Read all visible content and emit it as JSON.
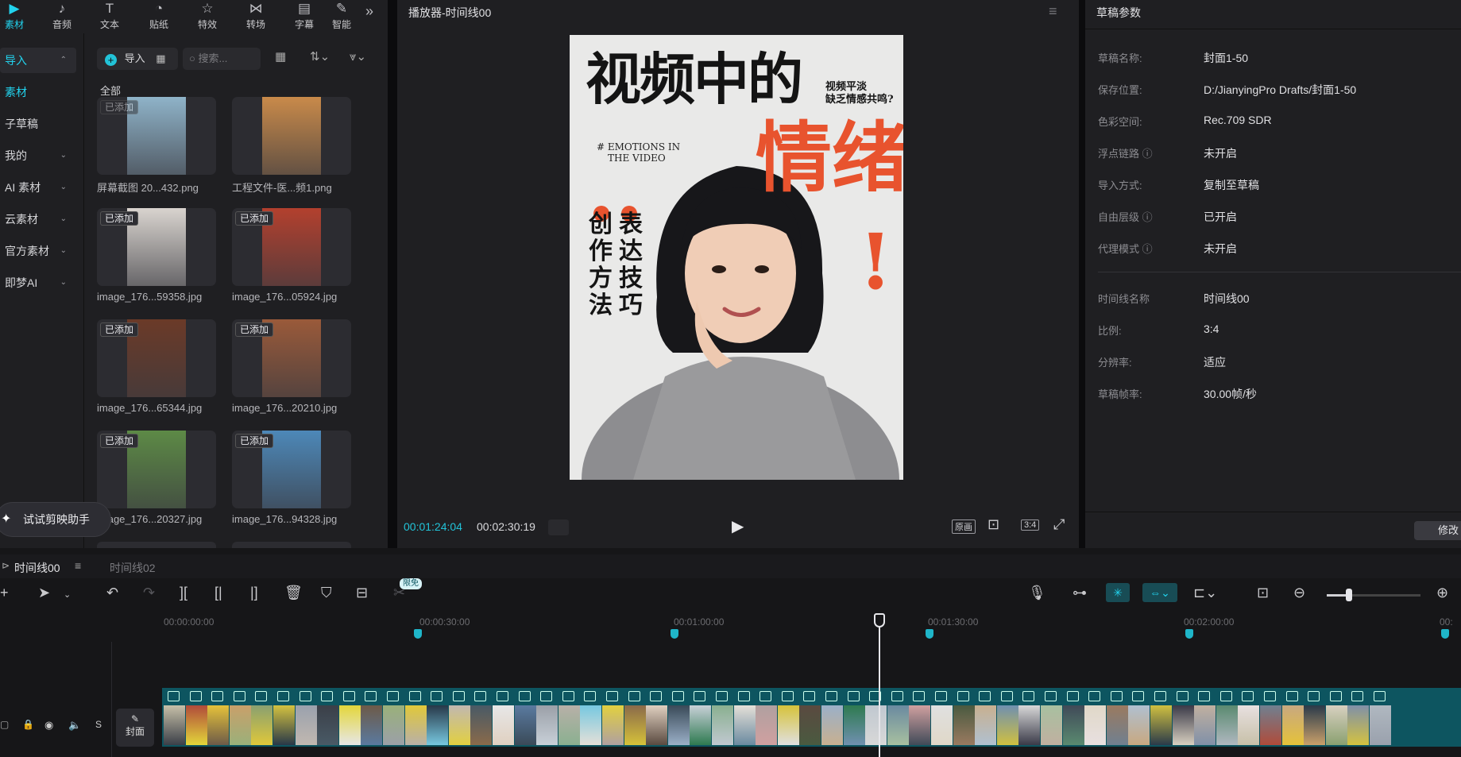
{
  "toolbar": {
    "items": [
      {
        "label": "素材",
        "icon": "media-icon",
        "active": true
      },
      {
        "label": "音频",
        "icon": "audio-icon"
      },
      {
        "label": "文本",
        "icon": "text-icon"
      },
      {
        "label": "贴纸",
        "icon": "sticker-icon"
      },
      {
        "label": "特效",
        "icon": "effects-icon"
      },
      {
        "label": "转场",
        "icon": "transition-icon"
      },
      {
        "label": "字幕",
        "icon": "subtitle-icon"
      },
      {
        "label": "智能",
        "icon": "smart-icon"
      }
    ],
    "more": "»"
  },
  "sidebar": {
    "items": [
      {
        "label": "导入",
        "chevron": "⌃"
      },
      {
        "label": "素材"
      },
      {
        "label": "子草稿"
      },
      {
        "label": "我的",
        "chevron": "⌄"
      },
      {
        "label": "AI 素材",
        "chevron": "⌄"
      },
      {
        "label": "云素材",
        "chevron": "⌄"
      },
      {
        "label": "官方素材",
        "chevron": "⌄"
      },
      {
        "label": "即梦AI",
        "chevron": "⌄"
      }
    ]
  },
  "media": {
    "import_label": "导入",
    "search_placeholder": "搜索...",
    "section_label": "全部",
    "cards": [
      {
        "badge": "已添加",
        "name": "屏幕截图 20...432.png",
        "color": "#8fb3c9"
      },
      {
        "badge": "",
        "name": "工程文件-医...频1.png",
        "color": "#c98a4a"
      },
      {
        "badge": "已添加",
        "name": "image_176...59358.jpg",
        "color": "#d9d4cf"
      },
      {
        "badge": "已添加",
        "name": "image_176...05924.jpg",
        "color": "#b3402e"
      },
      {
        "badge": "已添加",
        "name": "image_176...65344.jpg",
        "color": "#6b3a28"
      },
      {
        "badge": "已添加",
        "name": "image_176...20210.jpg",
        "color": "#9a5a3a"
      },
      {
        "badge": "已添加",
        "name": "image_176...20327.jpg",
        "color": "#5d8a46"
      },
      {
        "badge": "已添加",
        "name": "image_176...94328.jpg",
        "color": "#4d88b8"
      }
    ],
    "assistant_label": "试试剪映助手"
  },
  "player": {
    "title": "播放器-时间线00",
    "current_time": "00:01:24:04",
    "total_time": "00:02:30:19",
    "ratio_btn": "3:4",
    "original_btn": "原画"
  },
  "poster": {
    "title": "视频中的",
    "side_note_1": "视频平淡",
    "side_note_2": "缺乏情感共鸣?",
    "hashtag_1": "# EMOTIONS IN",
    "hashtag_2": "THE VIDEO",
    "emotion": "情绪",
    "vertical_1": "表达技巧",
    "vertical_2": "创作方法",
    "exclaim": "!"
  },
  "props": {
    "title": "草稿参数",
    "rows": [
      {
        "label": "草稿名称:",
        "value": "封面1-50"
      },
      {
        "label": "保存位置:",
        "value": "D:/JianyingPro Drafts/封面1-50"
      },
      {
        "label": "色彩空间:",
        "value": "Rec.709 SDR"
      },
      {
        "label": "浮点链路",
        "value": "未开启"
      },
      {
        "label": "导入方式:",
        "value": "复制至草稿"
      },
      {
        "label": "自由层级",
        "value": "已开启"
      },
      {
        "label": "代理模式",
        "value": "未开启"
      },
      {
        "label": "时间线名称",
        "value": "时间线00"
      },
      {
        "label": "比例:",
        "value": "3:4"
      },
      {
        "label": "分辨率:",
        "value": "适应"
      },
      {
        "label": "草稿帧率:",
        "value": "30.00帧/秒"
      }
    ],
    "modify_btn": "修改"
  },
  "timeline": {
    "tabs": [
      "时间线00",
      "时间线02"
    ],
    "badge": "限免",
    "ruler": [
      "00:00:00:00",
      "00:00:30:00",
      "00:01:00:00",
      "00:01:30:00",
      "00:02:00:00",
      "00:"
    ],
    "cover_label": "封面",
    "track_s": "S",
    "frame_colors": [
      "#c7c0a8",
      "#b04b3a",
      "#e5c23a",
      "#c9a06a",
      "#8aa070",
      "#d4c240",
      "#9aa1ad",
      "#3b3f48",
      "#e3d63a",
      "#6d5a48",
      "#9ab07a",
      "#e0c83a",
      "#283848",
      "#c1b8b0",
      "#495a66",
      "#e7e7e7",
      "#5a7aa0",
      "#9ba0a8",
      "#b8b0a8",
      "#77c8e0",
      "#e2d040",
      "#8a6a4a",
      "#e0d0c0",
      "#3a4a58",
      "#c8d0d8",
      "#8ab090",
      "#e5e0d8",
      "#b0a0a0",
      "#d6c23a",
      "#5a4a40",
      "#9bb0c8",
      "#2e7a50",
      "#c0c8d0",
      "#6a8aa0",
      "#d0a0a0",
      "#e0e0e0",
      "#4a5a40",
      "#c8b090",
      "#7090b0",
      "#d8d8d8",
      "#a8c0a0",
      "#404a58",
      "#e0d8c8",
      "#9a7a60",
      "#b0c0d0",
      "#d0c040",
      "#3a3a48",
      "#c0b0a0",
      "#5a8a70",
      "#e8e0e0",
      "#708090",
      "#c8a880",
      "#2a3a4a",
      "#d8d0c0",
      "#8090a8",
      "#b0b8c0"
    ]
  }
}
